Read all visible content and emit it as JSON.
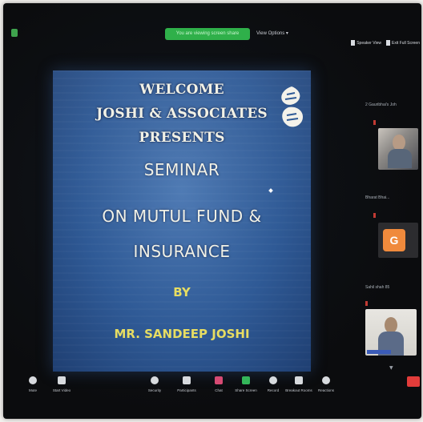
{
  "top_bar": {
    "share_status": "You are viewing screen share",
    "view_options": "View Options ▾",
    "view_controls": [
      "Speaker View",
      "Exit Full Screen"
    ]
  },
  "slide": {
    "line1": "WELCOME",
    "line2": "JOSHI & ASSOCIATES",
    "line3": "PRESENTS",
    "line4": "SEMINAR",
    "line5": "ON MUTUL FUND &",
    "line6": "INSURANCE",
    "line7": "BY",
    "line8": "MR. SANDEEP JOSHI",
    "logo_icon": "hands-logo-icon"
  },
  "participants_panel": {
    "header": "2 Gauribhai's Joh",
    "row2_label": "Bharat Bhai...",
    "row3_label": "Sahil shah 85",
    "avatar_letter": "G",
    "accent": "#f08a3c"
  },
  "toolbar": {
    "items": [
      {
        "label": "Mute",
        "icon": "microphone-icon"
      },
      {
        "label": "Start Video",
        "icon": "video-camera-icon"
      },
      {
        "label": "Security",
        "icon": "shield-icon"
      },
      {
        "label": "Participants",
        "icon": "participants-icon"
      },
      {
        "label": "Chat",
        "icon": "chat-icon"
      },
      {
        "label": "Share Screen",
        "icon": "share-screen-icon"
      },
      {
        "label": "Record",
        "icon": "record-icon"
      },
      {
        "label": "Breakout Rooms",
        "icon": "breakout-rooms-icon"
      },
      {
        "label": "Reactions",
        "icon": "reactions-icon"
      }
    ],
    "end_color": "#e23c3a"
  }
}
